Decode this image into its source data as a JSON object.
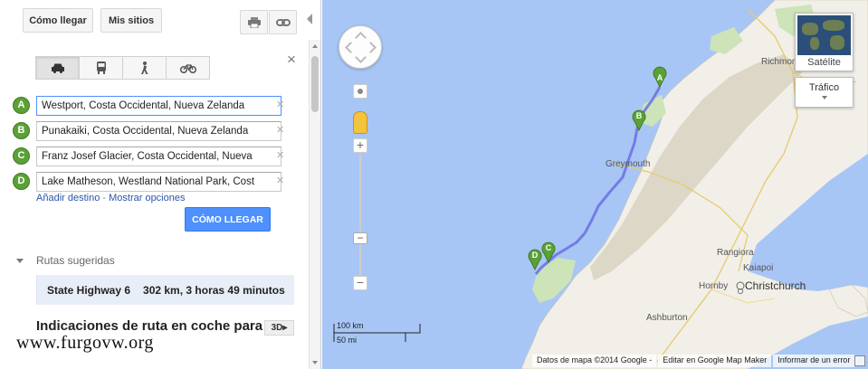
{
  "header": {
    "directions_tab": "Cómo llegar",
    "my_places_tab": "Mis sitios",
    "print_icon": "printer-icon",
    "link_icon": "link-icon"
  },
  "modes": [
    {
      "name": "car",
      "icon": "car-icon",
      "active": true
    },
    {
      "name": "transit",
      "icon": "bus-icon",
      "active": false
    },
    {
      "name": "walk",
      "icon": "walking-icon",
      "active": false
    },
    {
      "name": "bike",
      "icon": "bicycle-icon",
      "active": false
    }
  ],
  "waypoints": [
    {
      "marker": "A",
      "value": "Westport, Costa Occidental, Nueva Zelanda"
    },
    {
      "marker": "B",
      "value": "Punakaiki, Costa Occidental, Nueva Zelanda"
    },
    {
      "marker": "C",
      "value": "Franz Josef Glacier, Costa Occidental, Nueva"
    },
    {
      "marker": "D",
      "value": "Lake Matheson, Westland National Park, Cost"
    }
  ],
  "links": {
    "add_destination": "Añadir destino",
    "separator": " - ",
    "show_options": "Mostrar opciones"
  },
  "go_button": "CÓMO LLEGAR",
  "suggested": {
    "heading": "Rutas sugeridas",
    "route_name": "State Highway 6",
    "route_summary": "302 km, 3 horas 49 minutos"
  },
  "driving": {
    "title": "Indicaciones de ruta en coche para",
    "three_d": "3D"
  },
  "watermark": "www.furgovw.org",
  "map": {
    "labels": {
      "richmond": "Richmond",
      "greymouth": "Greymouth",
      "rangiora": "Rangiora",
      "kaiapoi": "Kaiapoi",
      "hornby": "Hornby",
      "christchurch": "Christchurch",
      "ashburton": "Ashburton"
    },
    "markers": [
      "A",
      "B",
      "C",
      "D"
    ],
    "satellite_label": "Satélite",
    "traffic_label": "Tráfico",
    "scale_km": "100 km",
    "scale_mi": "50 mi",
    "attribution": "Datos de mapa ©2014 Google -",
    "edit_link": "Editar en Google Map Maker",
    "report_link": "Informar de un error",
    "colors": {
      "water": "#a8c6f5",
      "land": "#f1efe8",
      "park": "#cde3b8",
      "route": "#6a6ee0",
      "marker": "#5ba137"
    }
  }
}
